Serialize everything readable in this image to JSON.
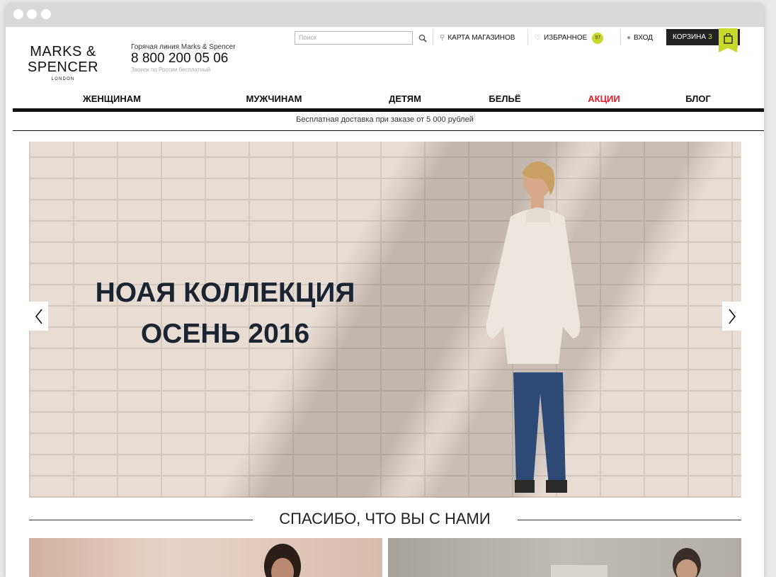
{
  "header": {
    "search_placeholder": "Поиск",
    "store_map": "КАРТА МАГАЗИНОВ",
    "favorites": "ИЗБРАННОЕ",
    "favorites_count": "97",
    "login": "ВХОД",
    "cart_label": "КОРЗИНА",
    "cart_count": "3",
    "accent_color": "#c7d92a"
  },
  "logo": {
    "line1": "MARKS &",
    "line2": "SPENCER",
    "line3": "LONDON"
  },
  "hotline": {
    "label": "Горячая линия Marks & Spencer",
    "phone": "8 800 200 05 06",
    "note": "Звонок по России бесплатный"
  },
  "nav": {
    "items": [
      {
        "label": "ЖЕНЩИНАМ"
      },
      {
        "label": "МУЖЧИНАМ"
      },
      {
        "label": "ДЕТЯМ"
      },
      {
        "label": "БЕЛЬЁ"
      },
      {
        "label": "АКЦИИ"
      },
      {
        "label": "БЛОГ"
      }
    ],
    "sale_color": "#e3202b"
  },
  "promo": "Бесплатная доставка при заказе от 5 000 рублей",
  "hero": {
    "line1": "НОАЯ КОЛЛЕКЦИЯ",
    "line2": "ОСЕНЬ 2016"
  },
  "section": {
    "title": "СПАСИБО, ЧТО ВЫ С НАМИ"
  }
}
